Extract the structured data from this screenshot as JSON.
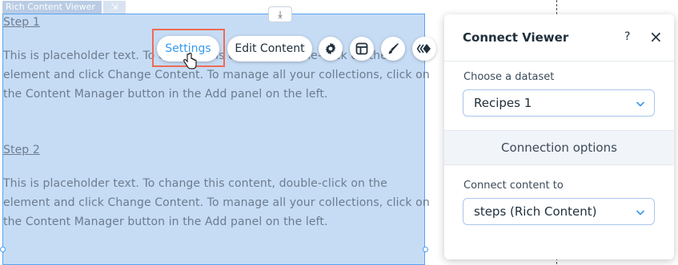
{
  "element": {
    "tag": "Rich Content Viewer",
    "step1_title": "Step 1",
    "step1_text": "This is placeholder text. To change this content, double-click on the element and click Change Content. To manage all your collections, click on the Content Manager button in the Add panel on the left.",
    "step2_title": "Step 2",
    "step2_text": "This is placeholder text. To change this content, double-click on the element and click Change Content. To manage all your collections, click on the Content Manager button in the Add panel on the left."
  },
  "toolbar": {
    "settings_label": "Settings",
    "edit_content_label": "Edit Content",
    "icons": [
      "gear-icon",
      "layout-icon",
      "design-brush-icon",
      "animation-icon"
    ]
  },
  "panel": {
    "title": "Connect Viewer",
    "help_icon": "?",
    "close_icon": "×",
    "dataset_label": "Choose a dataset",
    "dataset_value": "Recipes 1",
    "connection_options": "Connection options",
    "connect_label": "Connect content to",
    "connect_value": "steps (Rich Content)"
  },
  "colors": {
    "selection_fill": "#c6dcf5",
    "selection_border": "#5aa3f0",
    "highlight": "#ef6a55",
    "accent": "#3899ec"
  }
}
